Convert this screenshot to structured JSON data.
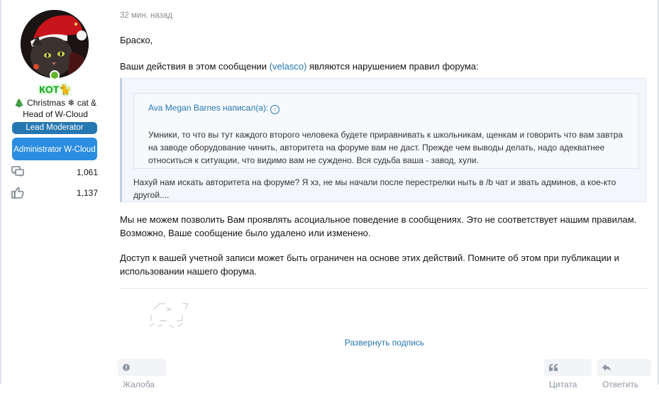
{
  "user": {
    "username": "КОТ🐈",
    "title": "🎄 Christmas ❄ cat & Head of W-Cloud",
    "banners": [
      "Lead Moderator",
      "Administrator W-Cloud"
    ],
    "stats": {
      "messages": "1,061",
      "reactions": "1,137"
    },
    "colors": {
      "username": "#1fa12a",
      "lead_banner": "#2577b1",
      "admin_banner": "#2b8de0"
    }
  },
  "post": {
    "timestamp": "32 мин. назад",
    "greeting": "Браско,",
    "p2_before": "Ваши действия в этом сообщении ",
    "p2_link": "(velasco)",
    "p2_after": " являются нарушением правил форума:",
    "quote": {
      "author": "Ava Megan Barnes написал(а):",
      "author_icon": "arrow-up-circle-icon",
      "nested_text": "Умники, то что вы тут каждого второго человека будете приравнивать к школьникам, щенкам и говорить что вам завтра на заводе оборудование чинить, авторитета на форуме вам не даст. Прежде чем выводы делать, надо адекватнее относиться к ситуации, что видимо вам не суждено. Вся судьба ваша - завод, хули.",
      "text": "Нахуй нам искать авторитета на форуме? Я хз, не мы начали после перестрелки ныть в /b чат и звать админов, а кое-кто другой...."
    },
    "p3": "Мы не можем позволить Вам проявлять асоциальное поведение в сообщениях. Это не соответствует нашим правилам. Возможно, Ваше сообщение было удалено или изменено.",
    "p4": "Доступ к вашей учетной записи может быть ограничен на основе этих действий. Помните об этом при публикации и использовании нашего форума."
  },
  "signature": {
    "expand_label": "Развернуть подпись"
  },
  "actions": {
    "report": "Жалоба",
    "quote": "Цитата",
    "reply": "Ответить"
  },
  "colors": {
    "link": "#2577b1",
    "muted": "#8f97a3"
  }
}
